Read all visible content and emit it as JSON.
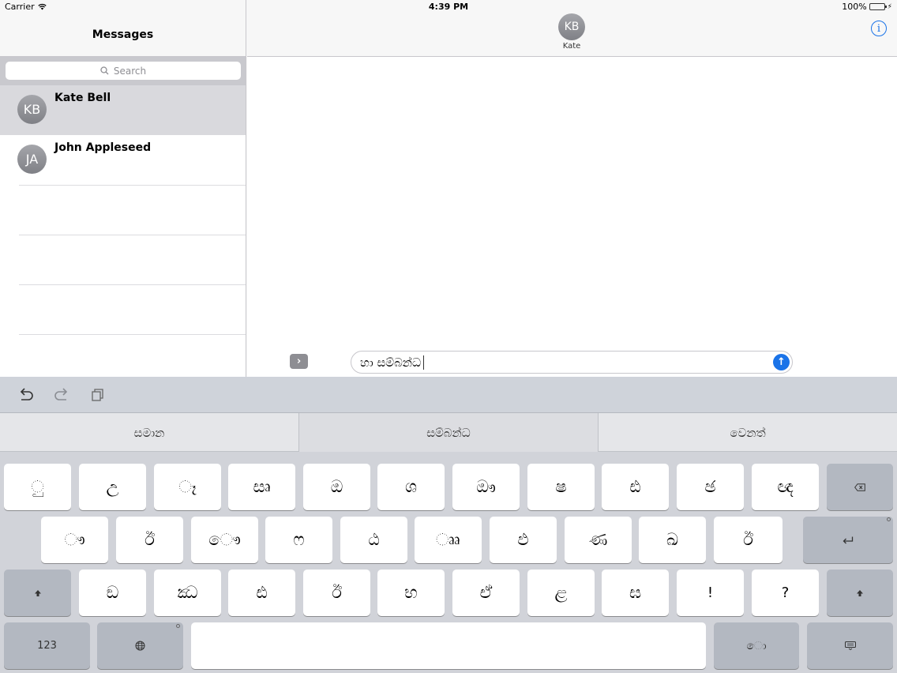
{
  "status_bar": {
    "carrier": "Carrier",
    "time": "4:39 PM",
    "battery": "100%",
    "icons": [
      "wifi-icon",
      "battery-icon",
      "charging-bolt-icon"
    ]
  },
  "left_pane": {
    "title": "Messages",
    "search_placeholder": "Search",
    "conversations": [
      {
        "initials": "KB",
        "name": "Kate Bell",
        "selected": true
      },
      {
        "initials": "JA",
        "name": "John Appleseed",
        "selected": false
      }
    ]
  },
  "conversation": {
    "contact_initials": "KB",
    "contact_name": "Kate",
    "expand_icon": "chevron-right-icon",
    "info_icon": "info-icon",
    "message_text": "හා සම්බන්ධ",
    "send_icon": "arrow-up-icon"
  },
  "keyboard": {
    "toolbar_icons": [
      "undo-icon",
      "redo-icon",
      "paste-icon"
    ],
    "suggestions": [
      "සමාන",
      "සම්බන්ධ",
      "වෙනත්"
    ],
    "rows": [
      [
        "ු",
        "උ",
        "ෑ",
        "සෘ",
        "ඔ",
        "ශ",
        "ඖ",
        "ෂ",
        "ඪ",
        "ඡ",
        "ඥ"
      ],
      [
        "ෟ",
        "ඊ",
        "ෞ",
        "ෆ",
        "ඨ",
        "ෲ",
        "ඵ",
        "ණ",
        "ඛ",
        "ඊ"
      ],
      [
        "ඞ",
        "ඣ",
        "ඪ",
        "ඊ",
        "භ",
        "ඒ",
        "ළ",
        "ඝ",
        "!",
        "?"
      ]
    ],
    "labels": {
      "numbers": "123",
      "vowel_sign": "ො"
    },
    "colors": {
      "accent": "#1a73e8",
      "battery": "#4cd964"
    }
  }
}
